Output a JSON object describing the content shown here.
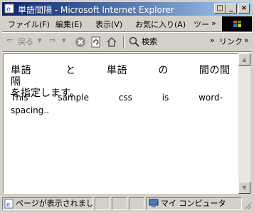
{
  "window": {
    "title": "単語間隔 - Microsoft Internet Explorer"
  },
  "menu": [
    "ファイル(F)",
    "編集(E)",
    "表示(V)",
    "お気に入り(A)",
    "ツー"
  ],
  "toolbar": {
    "back": "戻る",
    "search": "検索",
    "links": "リンク"
  },
  "content": {
    "line1_words": [
      "単語",
      "と",
      "単語",
      "の",
      "間の間隔"
    ],
    "line1_rest": "を指定します。",
    "line2": "This sample css is word-spacing.."
  },
  "status": {
    "message": "ページが表示されました",
    "zone": "マイ コンピュータ"
  }
}
